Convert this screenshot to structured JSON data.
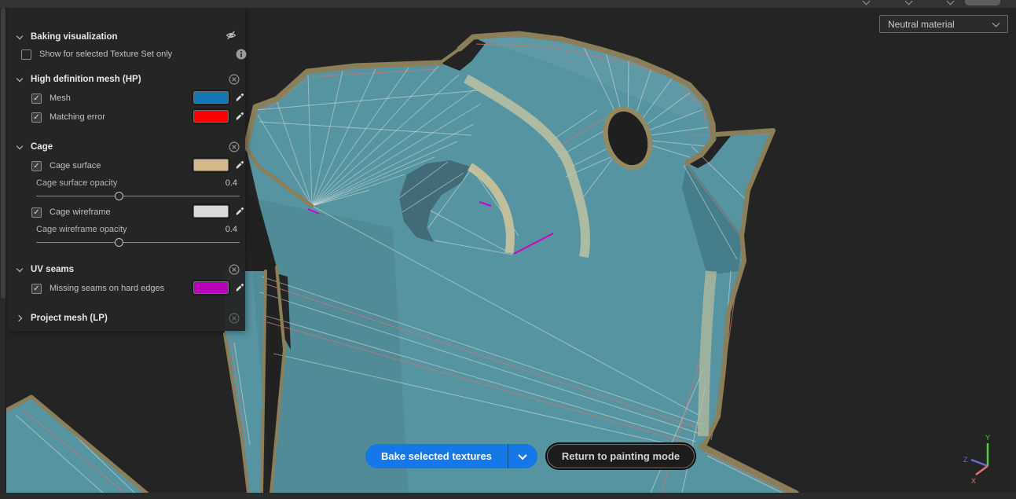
{
  "panel": {
    "title": "Baking visualization",
    "show_row": {
      "label": "Show for selected Texture Set only",
      "checked": false
    },
    "hp": {
      "title": "High definition mesh (HP)",
      "mesh": {
        "label": "Mesh",
        "checked": true,
        "color": "#1177b5"
      },
      "matching_error": {
        "label": "Matching error",
        "checked": true,
        "color": "#fb0100"
      }
    },
    "cage": {
      "title": "Cage",
      "surface": {
        "label": "Cage surface",
        "checked": true,
        "color": "#d3ba88"
      },
      "surface_opacity": {
        "label": "Cage surface opacity",
        "value": "0.4"
      },
      "wireframe": {
        "label": "Cage wireframe",
        "checked": true,
        "color": "#d9d9d9"
      },
      "wireframe_opacity": {
        "label": "Cage wireframe opacity",
        "value": "0.4"
      }
    },
    "uv": {
      "title": "UV seams",
      "missing": {
        "label": "Missing seams on hard edges",
        "checked": true,
        "color": "#bb00bb"
      }
    },
    "project": {
      "title": "Project mesh (LP)"
    }
  },
  "viewport": {
    "material_dropdown": "Neutral material",
    "axis": {
      "x": "X",
      "y": "Y",
      "z": "Z"
    },
    "axis_colors": {
      "x": "#e2736b",
      "y": "#59c946",
      "z": "#6b6bdb"
    }
  },
  "footer": {
    "bake_button": "Bake selected textures",
    "return_button": "Return to painting mode"
  }
}
